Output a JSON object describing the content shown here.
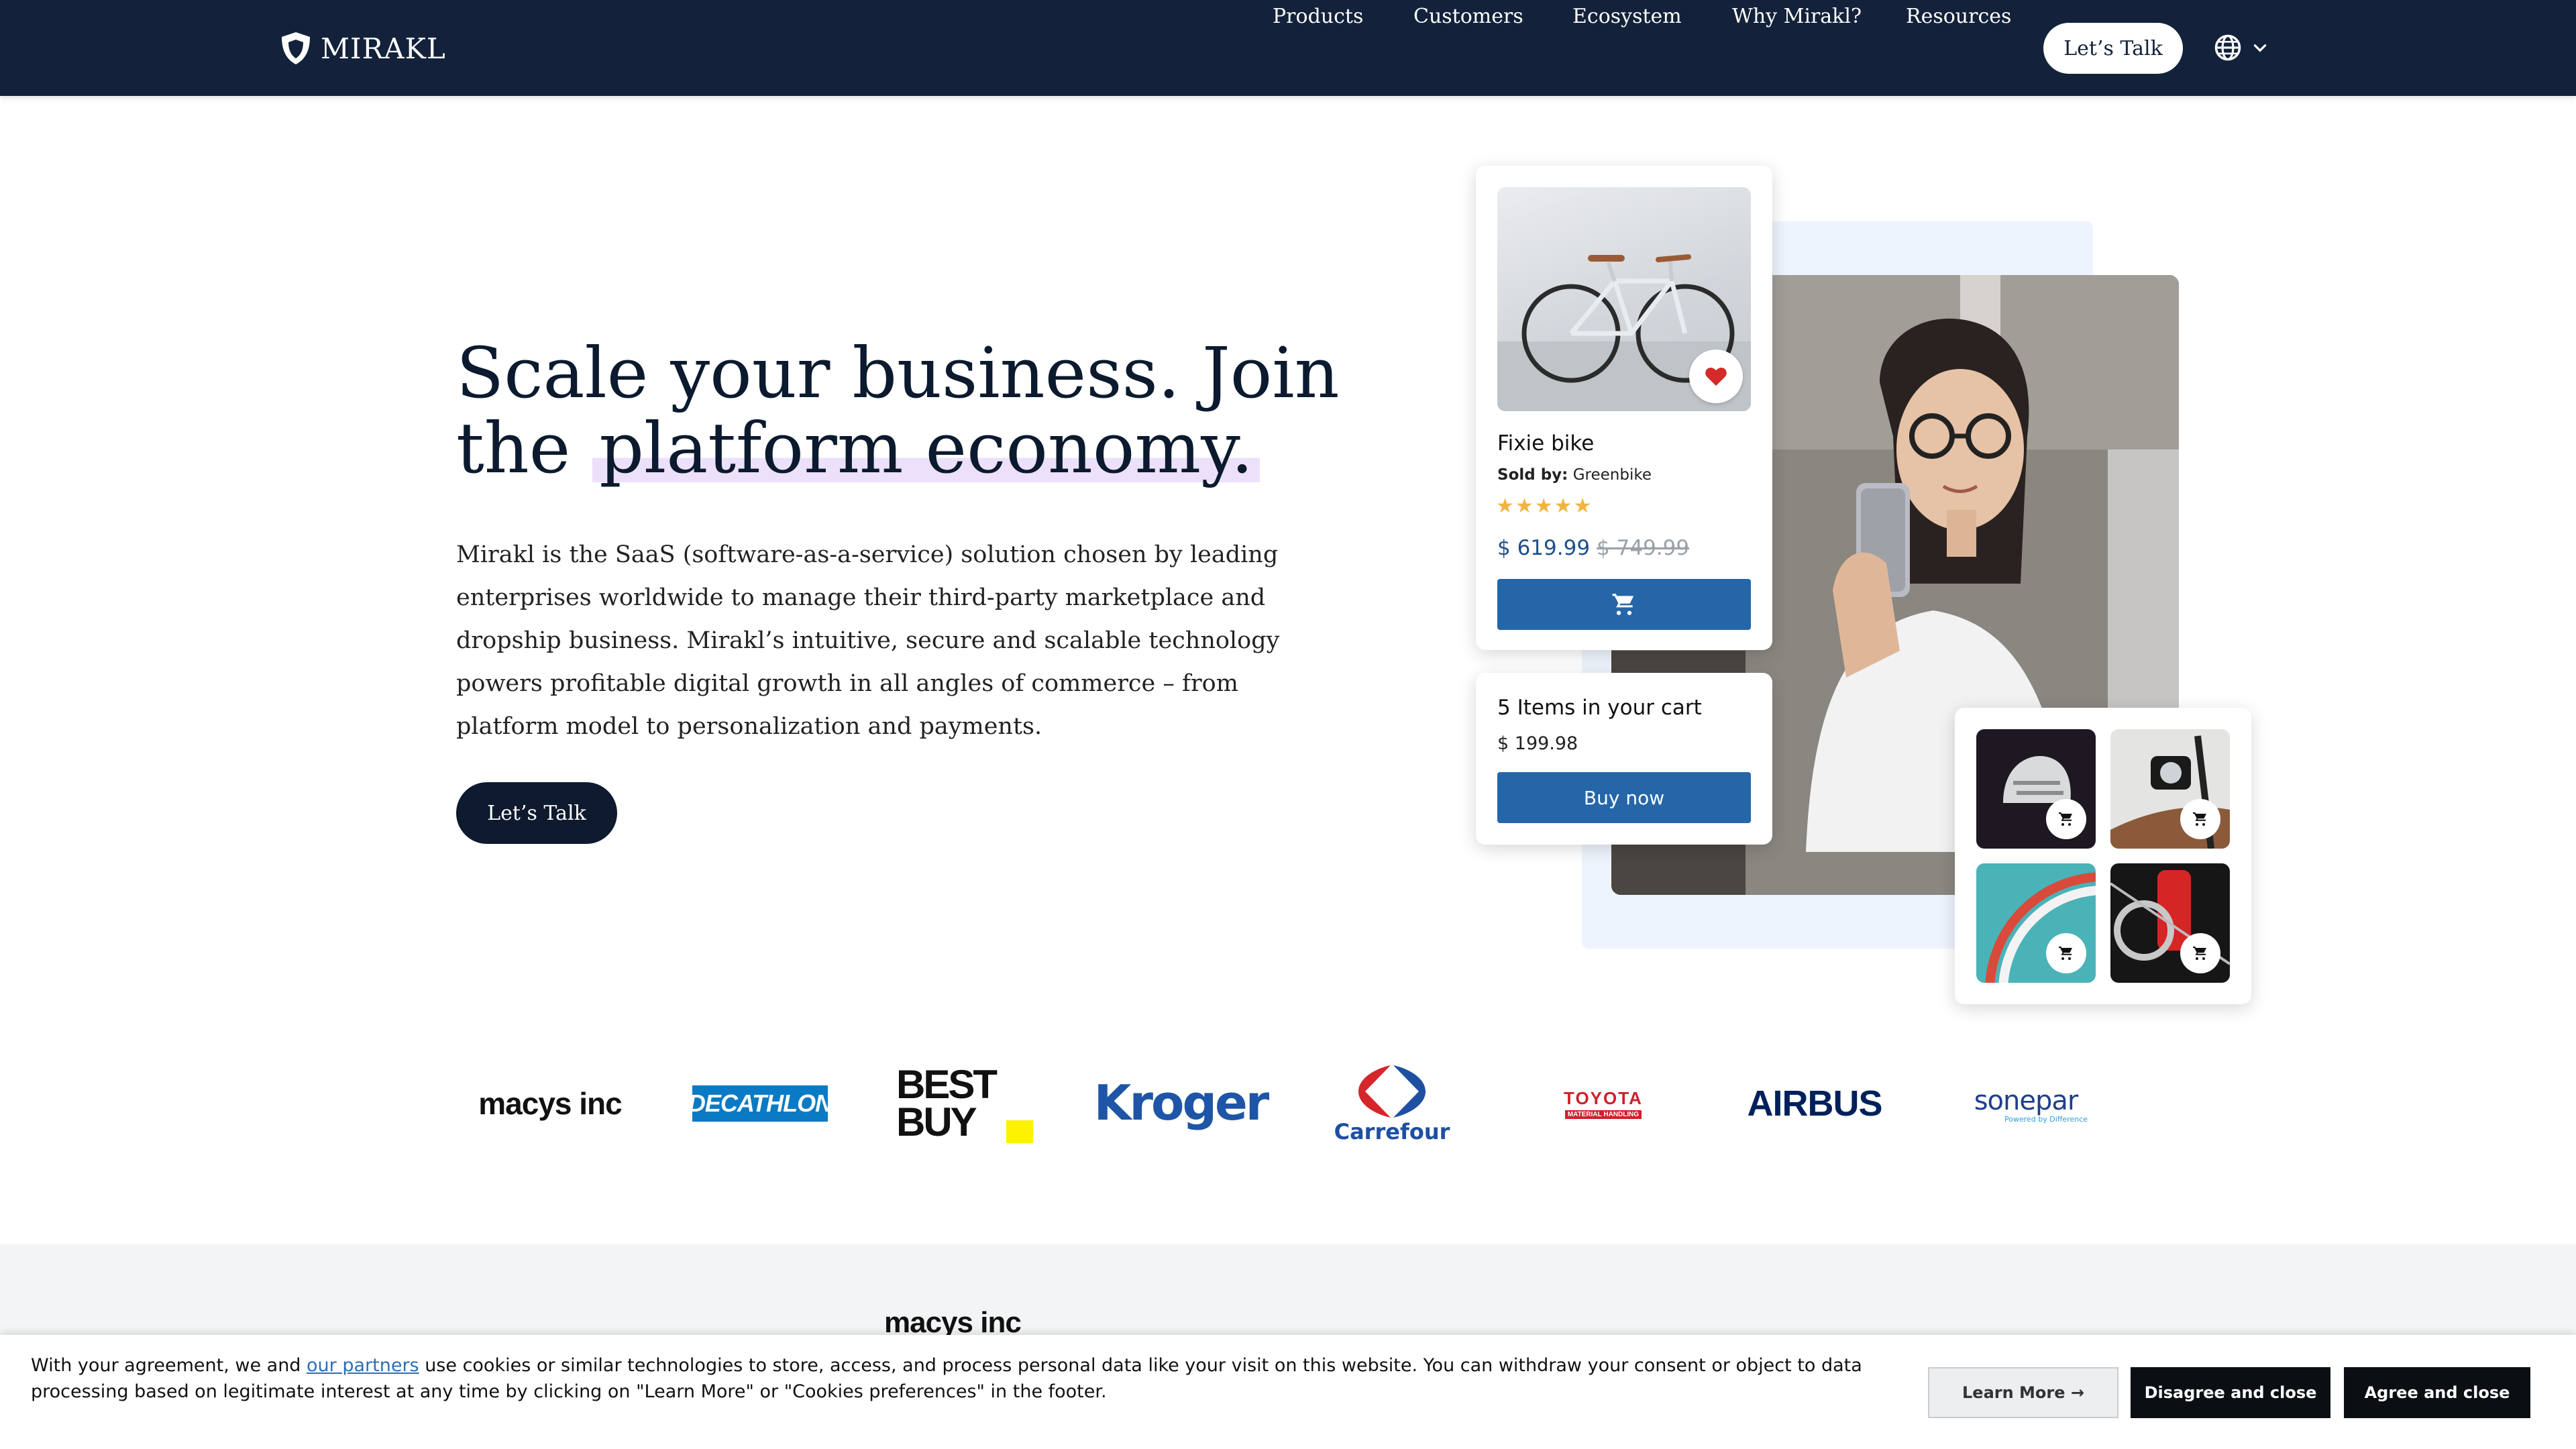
{
  "brand": {
    "name": "MIRAKL"
  },
  "nav": {
    "links": [
      "Products",
      "Customers",
      "Ecosystem",
      "Why Mirakl?",
      "Resources"
    ],
    "cta": "Let’s Talk",
    "language_icon": "globe-icon"
  },
  "hero": {
    "title_part1": "Scale your business. Join the ",
    "title_highlight": "platform economy.",
    "description": "Mirakl is the SaaS (software-as-a-service) solution chosen by leading enterprises worldwide to manage their third-party marketplace and dropship business. Mirakl’s intuitive, secure and scalable technology powers profitable digital growth in all angles of commerce – from platform model to personalization and payments.",
    "cta": "Let’s Talk"
  },
  "product_card": {
    "name": "Fixie bike",
    "seller_label": "Sold by:",
    "seller": "Greenbike",
    "rating": 5,
    "stars": "★★★★★",
    "price": "$ 619.99",
    "old_price": "$ 749.99"
  },
  "cart_card": {
    "title": "5 Items in your cart",
    "total": "$ 199.98",
    "button": "Buy now"
  },
  "customer_logos": [
    "macys inc",
    "DECATHLON",
    "BEST BUY",
    "Kroger",
    "Carrefour",
    "TOYOTA",
    "AIRBUS",
    "sonepar"
  ],
  "logo_subtexts": {
    "toyota": "MATERIAL HANDLING",
    "sonepar": "Powered by Difference"
  },
  "lower_section": {
    "logo": "macys inc"
  },
  "cookie": {
    "text_before": "With your agreement, we and ",
    "link": "our partners",
    "text_after": " use cookies or similar technologies to store, access, and process personal data like your visit on this website. You can withdraw your consent or object to data processing based on legitimate interest at any time by clicking on \"Learn More\" or \"Cookies preferences\" in the footer.",
    "learn_more": "Learn More →",
    "disagree": "Disagree and close",
    "agree": "Agree and close"
  },
  "colors": {
    "nav_bg": "#13223a",
    "primary_dark": "#0e1a2e",
    "button_blue": "#2566a8",
    "highlight": "#ece0fb",
    "star": "#f2b441"
  }
}
